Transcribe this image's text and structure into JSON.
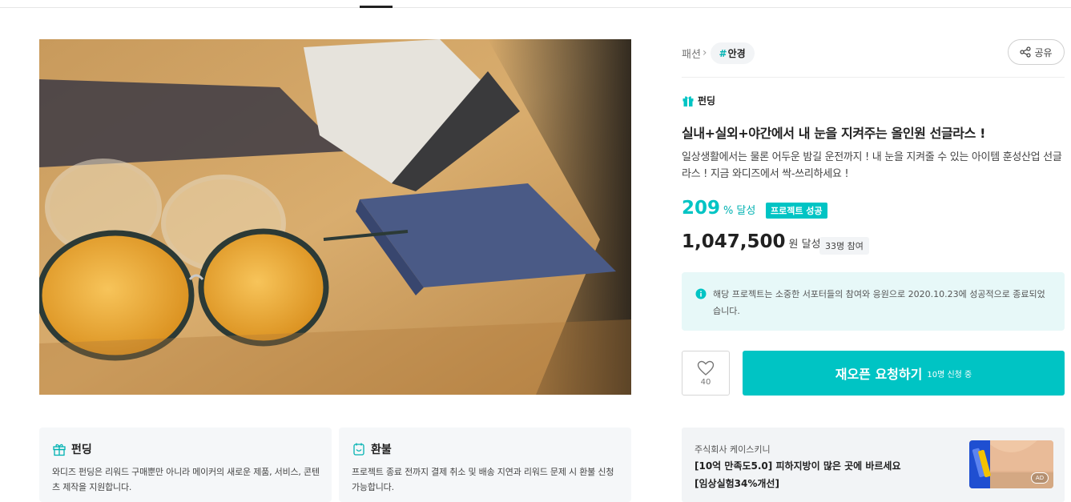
{
  "breadcrumb": {
    "category": "패션",
    "tag_hash": "#",
    "tag": "안경"
  },
  "share": {
    "label": "공유"
  },
  "project": {
    "kind": "펀딩",
    "title": "실내+실외+야간에서 내 눈을 지켜주는 올인원 선글라스 !",
    "description": "일상생활에서는 물론 어두운 밤길 운전까지 ! 내 눈을 지켜줄 수 있는 아이템 훈성산업 선글라스 ! 지금 와디즈에서 싹-쓰리하세요 !",
    "percent": "209",
    "percent_unit": "%",
    "percent_label": "달성",
    "status_badge": "프로젝트 성공",
    "amount": "1,047,500",
    "amount_unit": "원 달성",
    "supporters": "33명 참여"
  },
  "notice": {
    "text": "해당 프로젝트는 소중한 서포터들의 참여와 응원으로 2020.10.23에 성공적으로 종료되었습니다."
  },
  "actions": {
    "like_count": "40",
    "reopen_label": "재오픈 요청하기",
    "reopen_count": "10명 신청 중"
  },
  "ad": {
    "company": "주식회사 케이스키니",
    "line1": "[10억 만족도5.0] 피하지방이 많은 곳에 바르세요",
    "line2": "[임상실험34%개선]",
    "badge": "AD"
  },
  "info_cards": [
    {
      "title": "펀딩",
      "description": "와디즈 펀딩은 리워드 구매뿐만 아니라 메이커의 새로운 제품, 서비스, 콘텐츠 제작을 지원합니다."
    },
    {
      "title": "환불",
      "description": "프로젝트 종료 전까지 결제 취소 및 배송 지연과 리워드 문제 시 환불 신청 가능합니다."
    }
  ],
  "colors": {
    "accent": "#00c4c4",
    "notice_bg": "#e7f8f8",
    "card_bg": "#f5f7f9"
  }
}
